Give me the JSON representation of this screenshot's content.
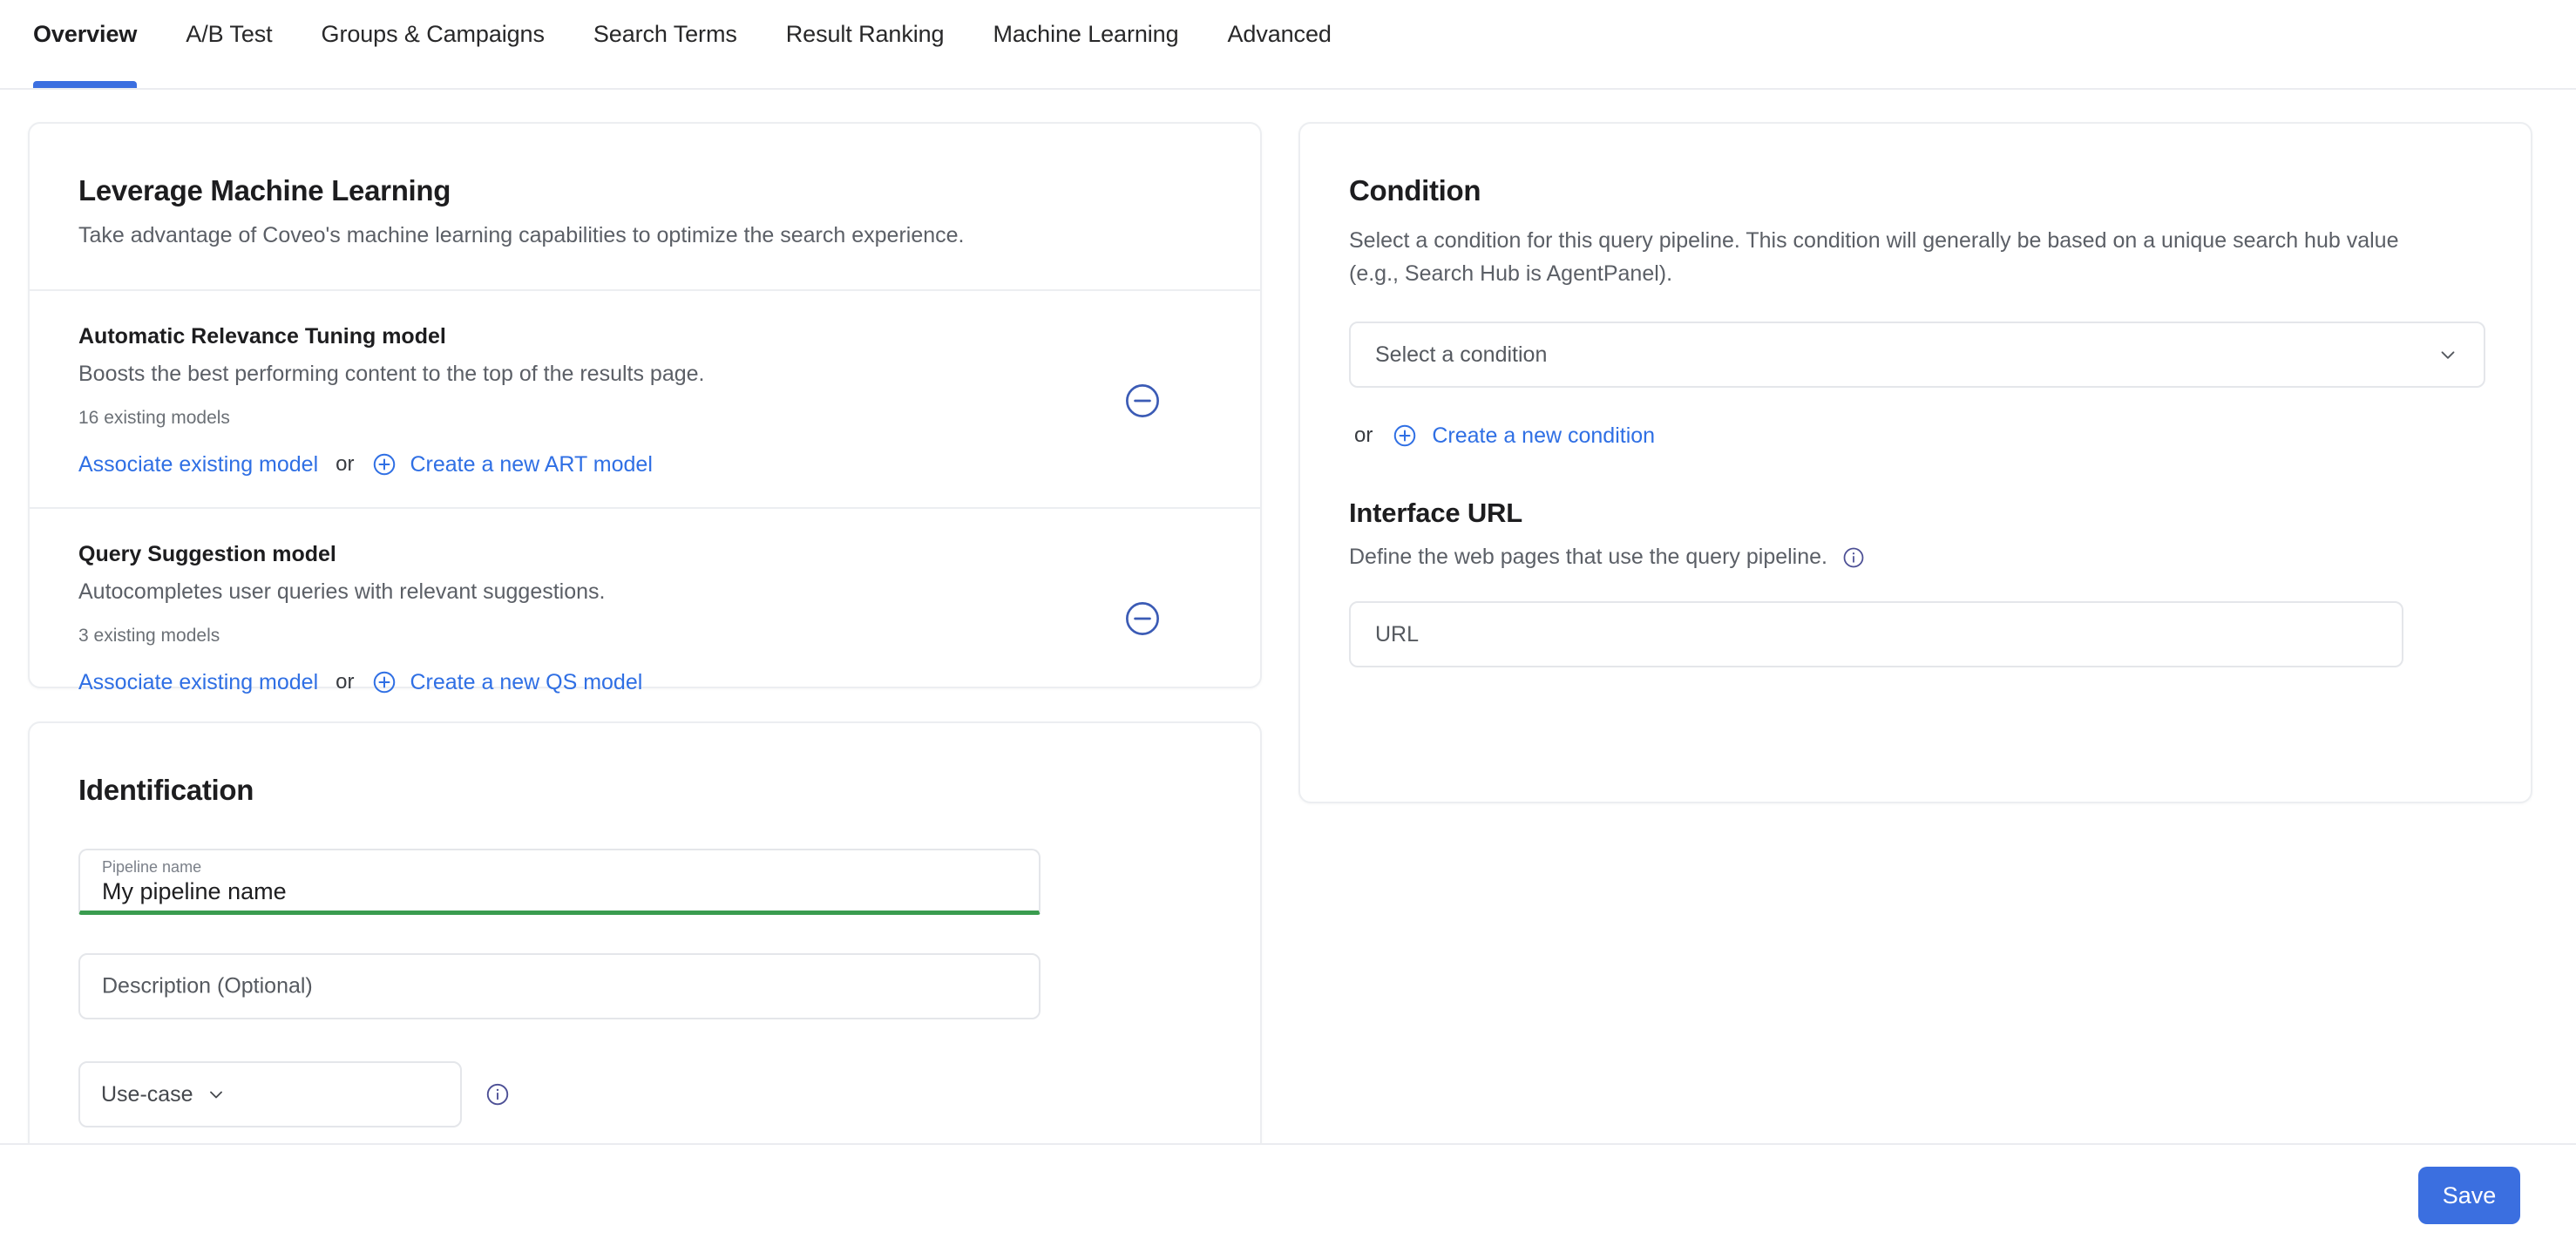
{
  "tabs": [
    {
      "label": "Overview",
      "active": true
    },
    {
      "label": "A/B Test",
      "active": false
    },
    {
      "label": "Groups & Campaigns",
      "active": false
    },
    {
      "label": "Search Terms",
      "active": false
    },
    {
      "label": "Result Ranking",
      "active": false
    },
    {
      "label": "Machine Learning",
      "active": false
    },
    {
      "label": "Advanced",
      "active": false
    }
  ],
  "machine_learning_card": {
    "title": "Leverage Machine Learning",
    "subtitle": "Take advantage of Coveo's machine learning capabilities to optimize the search experience.",
    "models": [
      {
        "name": "Automatic Relevance Tuning model",
        "description": "Boosts the best performing content to the top of the results page.",
        "existing_count": "16 existing models",
        "associate_label": "Associate existing model",
        "or_label": "or",
        "create_label": "Create a new ART model",
        "remove_icon": "minus-circle-icon",
        "add_icon": "plus-circle-icon"
      },
      {
        "name": "Query Suggestion model",
        "description": "Autocompletes user queries with relevant suggestions.",
        "existing_count": "3 existing models",
        "associate_label": "Associate existing model",
        "or_label": "or",
        "create_label": "Create a new QS model",
        "remove_icon": "minus-circle-icon",
        "add_icon": "plus-circle-icon"
      }
    ]
  },
  "identification_card": {
    "title": "Identification",
    "pipeline_name": {
      "label": "Pipeline name",
      "value": "My pipeline name",
      "state": "valid"
    },
    "description": {
      "placeholder": "Description (Optional)",
      "value": ""
    },
    "use_case": {
      "label": "Use-case",
      "chevron_icon": "chevron-down-icon",
      "info_icon": "info-circle-icon"
    }
  },
  "condition_card": {
    "title": "Condition",
    "subtitle": "Select a condition for this query pipeline. This condition will generally be based on a unique search hub value (e.g., Search Hub is AgentPanel).",
    "select": {
      "placeholder": "Select a condition",
      "chevron_icon": "chevron-down-icon"
    },
    "or_label": "or",
    "create_condition_label": "Create a new condition",
    "create_icon": "plus-circle-icon",
    "interface_url": {
      "title": "Interface URL",
      "description": "Define the web pages that use the query pipeline.",
      "info_icon": "info-circle-icon",
      "input_placeholder": "URL"
    }
  },
  "footer": {
    "save_label": "Save"
  },
  "colors": {
    "accent_blue": "#3b6fe0",
    "link_blue": "#2f6fe4",
    "valid_green": "#3a9c4f",
    "info_indigo": "#4c4f95",
    "border_grey": "#e4e6ea",
    "text_primary": "#1d1d1f",
    "text_secondary": "#5b5f66"
  }
}
